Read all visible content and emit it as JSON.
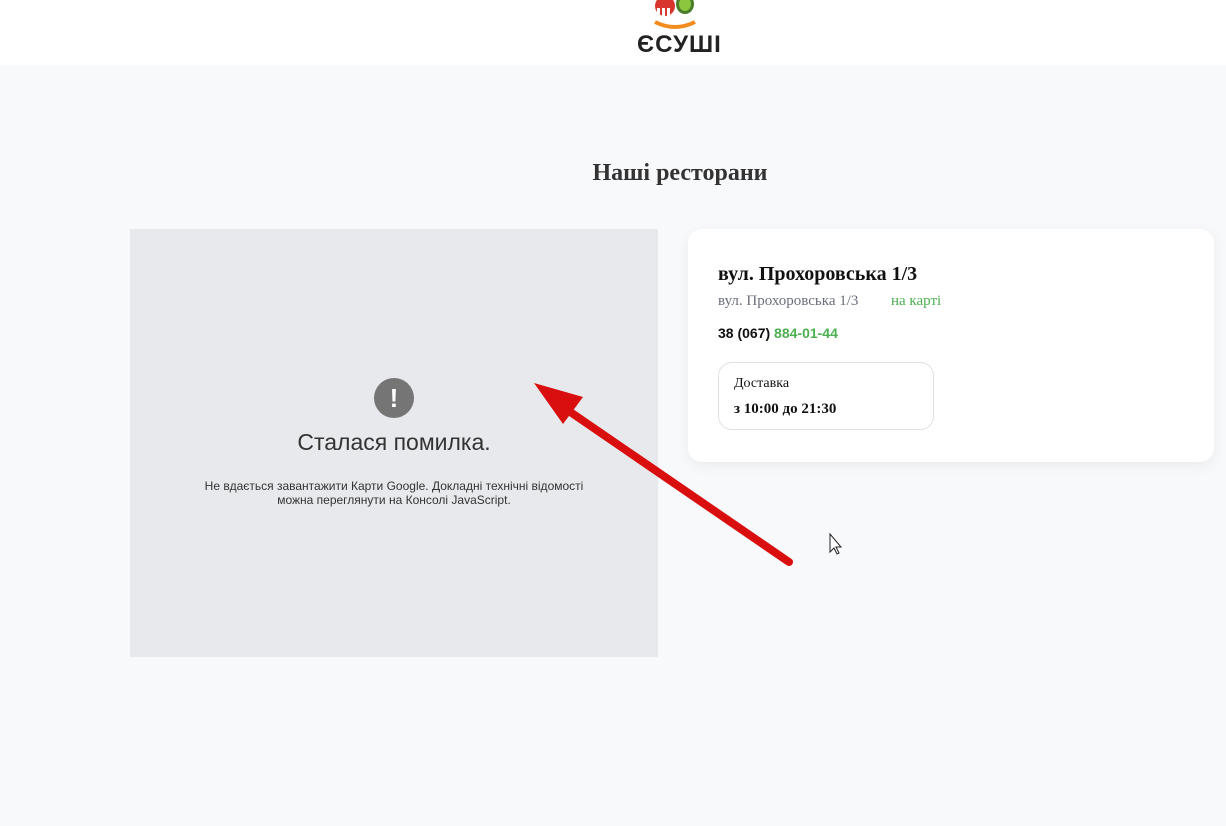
{
  "header": {
    "logo_text": "ЄСУШІ"
  },
  "main": {
    "title": "Наші ресторани"
  },
  "map": {
    "error_title": "Сталася помилка.",
    "error_line1": "Не вдається завантажити Карти Google. Докладні технічні відомості",
    "error_line2": "можна переглянути на Консолі JavaScript.",
    "error_icon": "!"
  },
  "restaurant": {
    "name": "вул. Прохоровська 1/3",
    "address": "вул. Прохоровська 1/3",
    "map_link": "на карті",
    "phone_prefix": "38 (067)",
    "phone_number": "884-01-44",
    "delivery_label": "Доставка",
    "delivery_hours": "з 10:00 до 21:30"
  },
  "colors": {
    "accent": "#4caf50",
    "arrow": "#d90f0f",
    "logo_orange": "#f28c1d",
    "logo_green": "#6aa532"
  },
  "icons": [
    "logo-mark-icon",
    "error-icon",
    "red-arrow-annotation",
    "mouse-cursor-icon"
  ]
}
